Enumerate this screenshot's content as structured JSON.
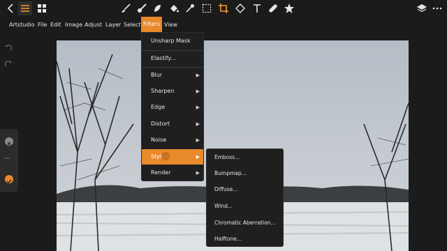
{
  "colors": {
    "accent": "#e8892b",
    "background": "#1b1b1b",
    "menu_bg": "#1f1f1f"
  },
  "toolbar": {
    "left_icons": [
      "back-chevron-icon",
      "hamburger-menu-icon",
      "grid-icon"
    ],
    "tools": [
      "brush-tool-icon",
      "paintbrush-tool-icon",
      "smudge-tool-icon",
      "fill-bucket-icon",
      "eyedropper-icon",
      "marquee-select-icon",
      "crop-icon",
      "eraser-icon",
      "text-tool-icon",
      "bandage-heal-icon",
      "star-shape-icon"
    ],
    "right_icons": [
      "layers-icon",
      "more-dots-icon"
    ]
  },
  "menubar": {
    "items": [
      "Artstudio",
      "File",
      "Edit",
      "Image",
      "Adjust",
      "Layer",
      "Select",
      "Filters",
      "View"
    ],
    "open": "Filters"
  },
  "filters_menu": {
    "top_items": [
      "Unsharp Mask",
      "Elastify..."
    ],
    "submenus": [
      "Blur",
      "Sharpen",
      "Edge",
      "Distort",
      "Noise",
      "Stylize",
      "Render"
    ],
    "highlighted": "Stylize",
    "arrow": "▶"
  },
  "stylize_menu": {
    "items": [
      "Emboss...",
      "Bumpmap...",
      "Diffuse...",
      "Wind...",
      "Chromatic Aberration...",
      "Halftone..."
    ]
  },
  "side_panel": {
    "buttons": [
      "close-icon",
      "more-options-icon",
      "confirm-icon"
    ],
    "more_glyph": "···"
  },
  "history": {
    "undo_icon": "undo-icon",
    "redo_icon": "redo-icon"
  },
  "canvas": {
    "description_icon": "photo-canvas"
  }
}
